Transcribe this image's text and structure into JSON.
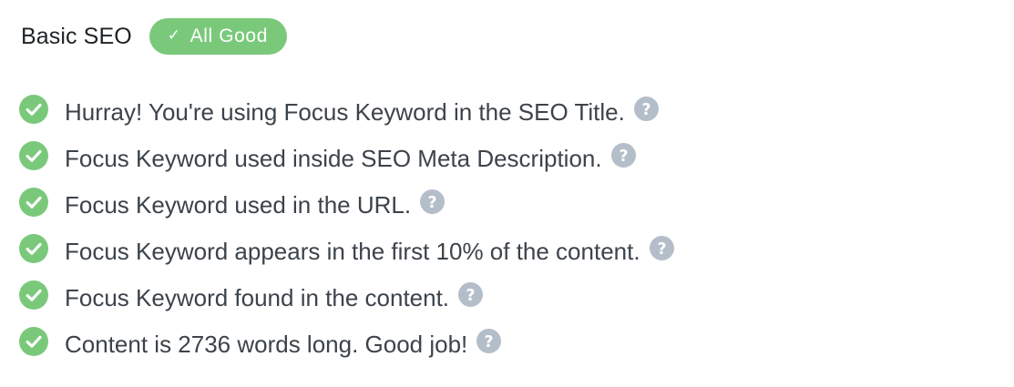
{
  "colors": {
    "success": "#7ac97b",
    "help_icon": "#b3bec9",
    "text": "#3c434a",
    "title": "#1d2327"
  },
  "section": {
    "title": "Basic SEO",
    "badge": {
      "icon": "check-icon",
      "label": "All Good"
    }
  },
  "tests": [
    {
      "status": "ok",
      "icon": "check-circle-icon",
      "text": "Hurray! You're using Focus Keyword in the SEO Title.",
      "help_icon": "question-circle-icon"
    },
    {
      "status": "ok",
      "icon": "check-circle-icon",
      "text": "Focus Keyword used inside SEO Meta Description.",
      "help_icon": "question-circle-icon"
    },
    {
      "status": "ok",
      "icon": "check-circle-icon",
      "text": "Focus Keyword used in the URL.",
      "help_icon": "question-circle-icon"
    },
    {
      "status": "ok",
      "icon": "check-circle-icon",
      "text": "Focus Keyword appears in the first 10% of the content.",
      "help_icon": "question-circle-icon"
    },
    {
      "status": "ok",
      "icon": "check-circle-icon",
      "text": "Focus Keyword found in the content.",
      "help_icon": "question-circle-icon"
    },
    {
      "status": "ok",
      "icon": "check-circle-icon",
      "text": "Content is 2736 words long. Good job!",
      "help_icon": "question-circle-icon"
    }
  ]
}
